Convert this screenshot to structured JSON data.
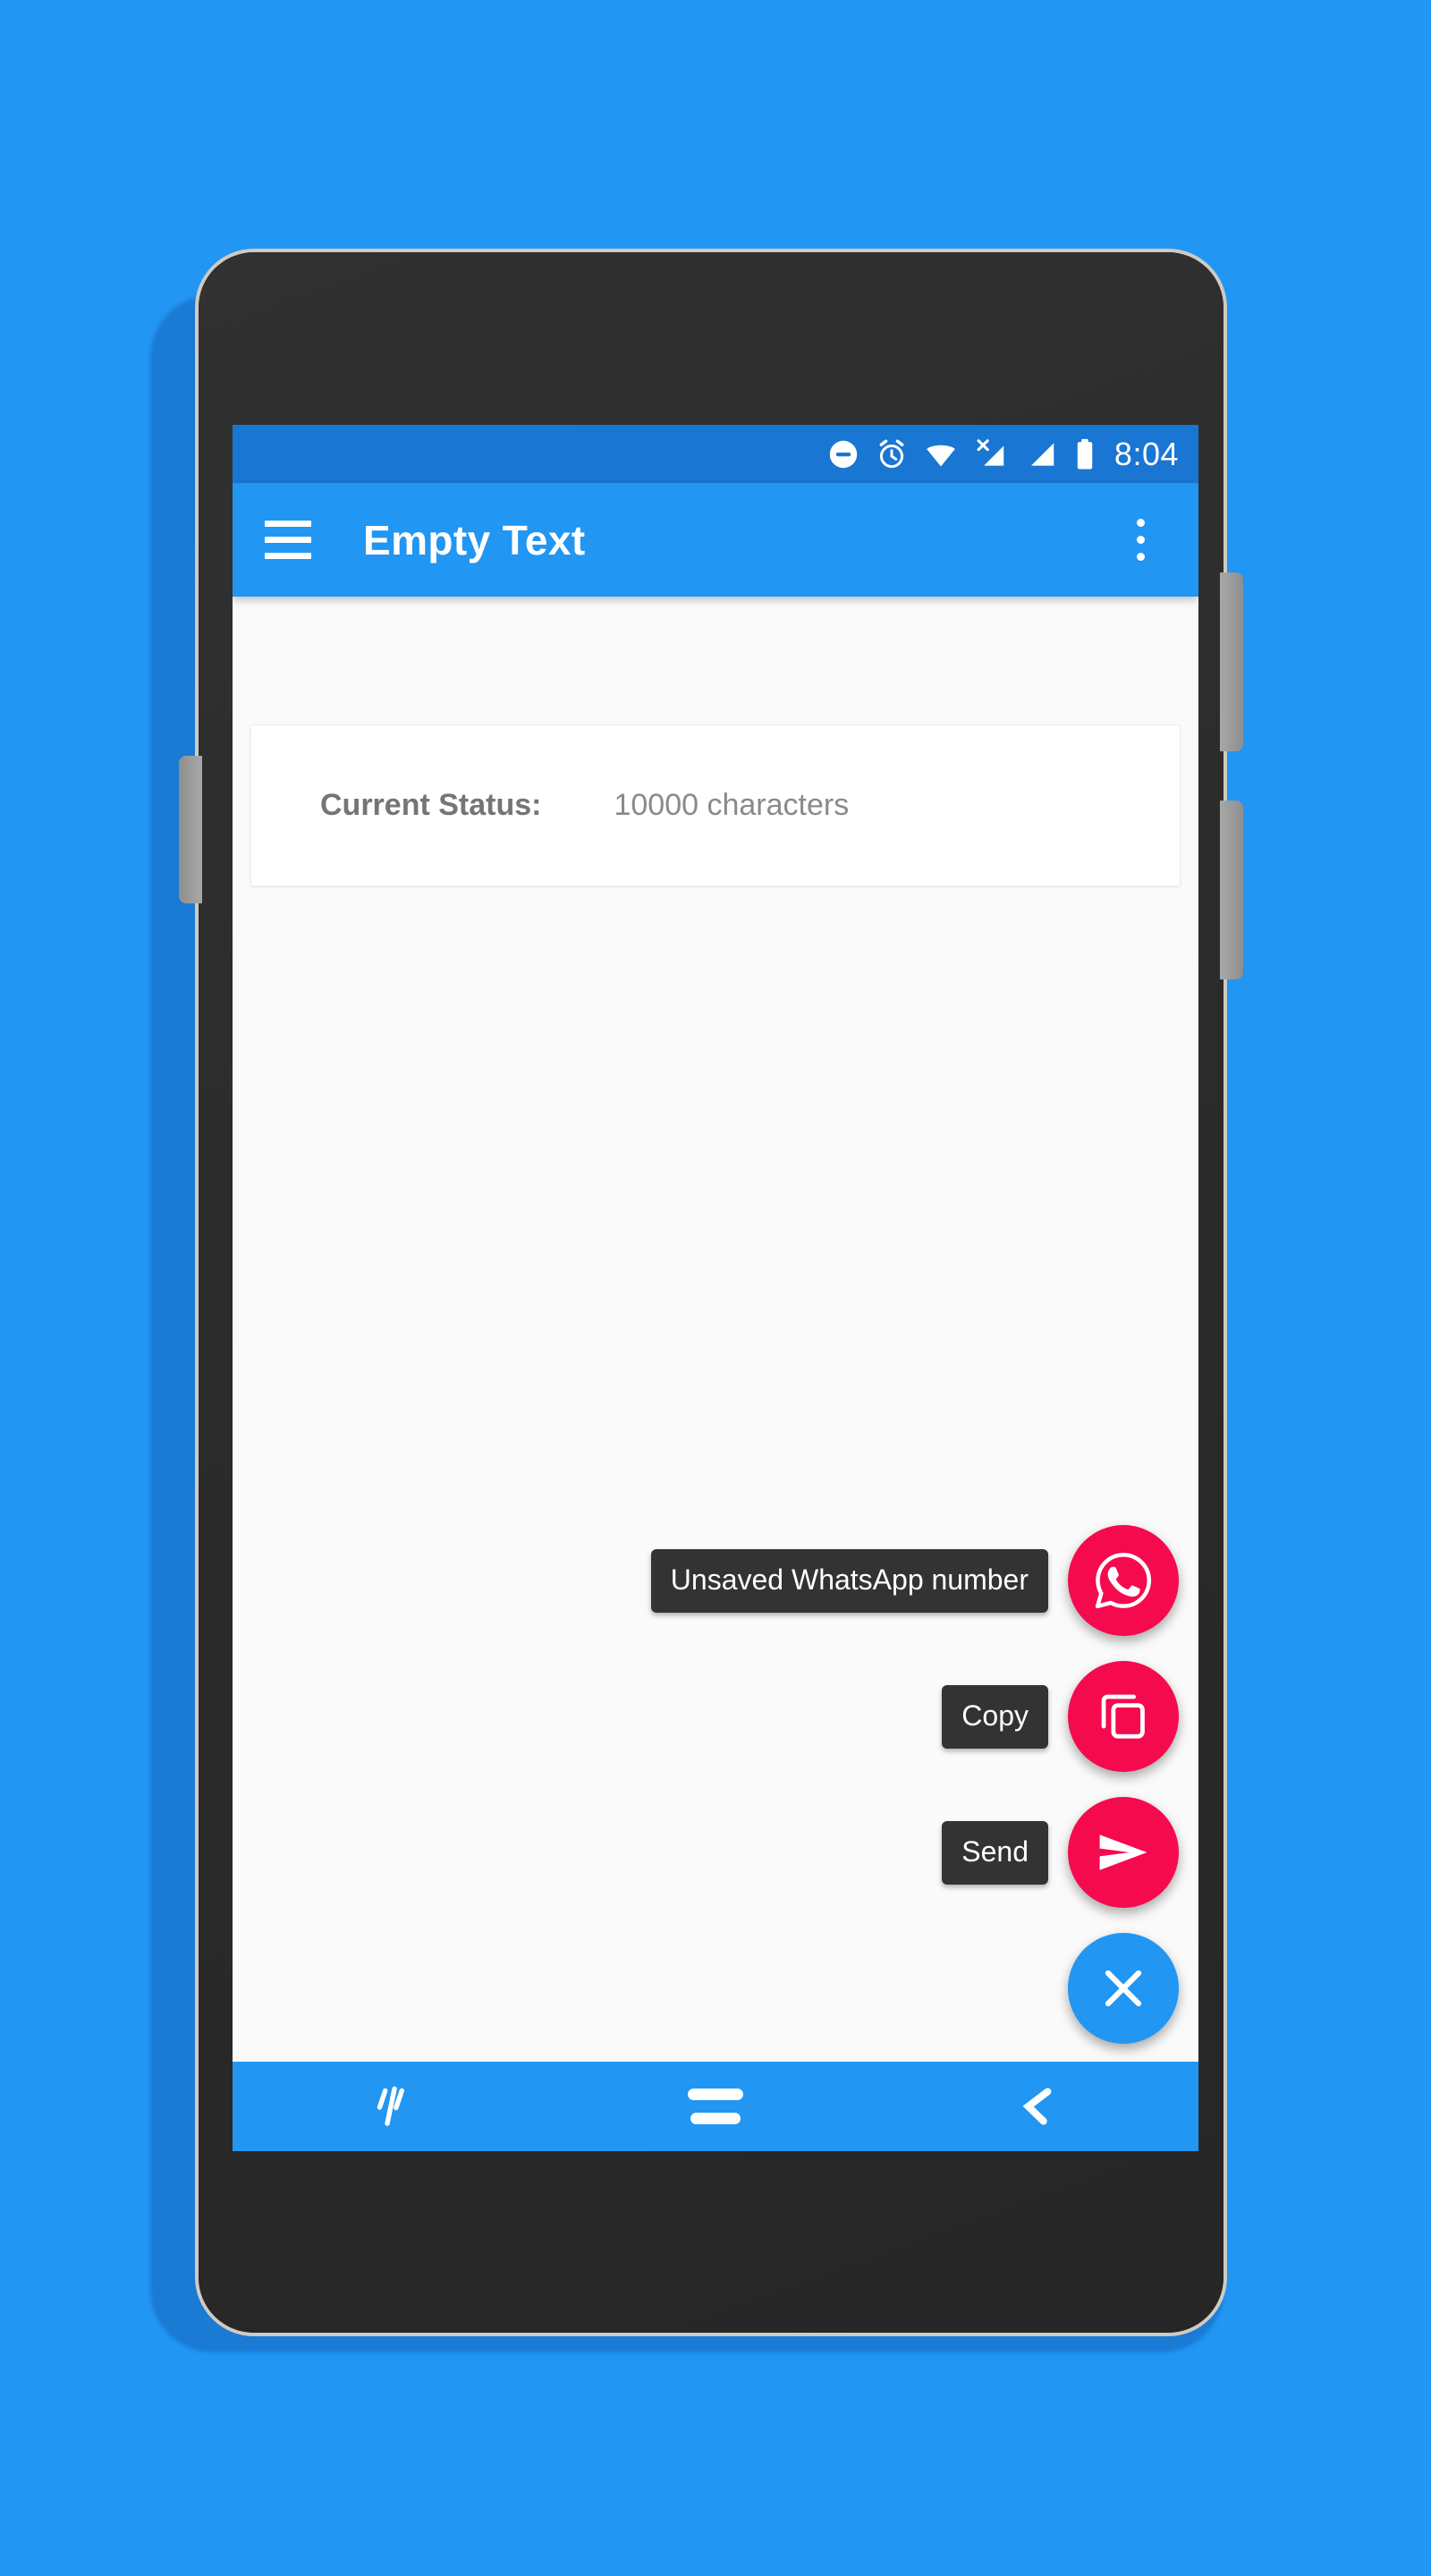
{
  "background": {
    "color": "#2196F3"
  },
  "device": {
    "body_color": "#2b2b2b",
    "bezel_color": "#cfcbc2",
    "shadow_color": "#1B7AD4",
    "parts": {
      "earpiece": "earpiece-speaker",
      "front_camera": "front-camera",
      "home_button": "home-button",
      "power_button": "power-button",
      "volume_up_button": "volume-up-button",
      "volume_down_button": "volume-down-button"
    }
  },
  "status_bar": {
    "background": "#1976D2",
    "time": "8:04",
    "icons": [
      {
        "name": "do-not-disturb-icon",
        "label": "Do not disturb"
      },
      {
        "name": "alarm-clock-icon",
        "label": "Alarm set"
      },
      {
        "name": "wifi-icon",
        "label": "Wi-Fi connected"
      },
      {
        "name": "signal-no-sim-icon",
        "label": "No SIM signal"
      },
      {
        "name": "signal-icon",
        "label": "Mobile signal"
      },
      {
        "name": "battery-icon",
        "label": "Battery full"
      }
    ]
  },
  "app_bar": {
    "background": "#2196F3",
    "title": "Empty Text",
    "navigation_icon": "hamburger-menu-icon",
    "overflow_icon": "overflow-menu-icon"
  },
  "content": {
    "background": "#FAFAFA",
    "status_card": {
      "label": "Current Status:",
      "value": "10000 characters"
    }
  },
  "fab_menu": {
    "expanded": true,
    "accent_color": "#F50A4E",
    "close_color": "#2196F3",
    "actions": [
      {
        "label": "Unsaved WhatsApp number",
        "icon": "whatsapp-icon",
        "color": "#F50A4E"
      },
      {
        "label": "Copy",
        "icon": "copy-icon",
        "color": "#F50A4E"
      },
      {
        "label": "Send",
        "icon": "send-icon",
        "color": "#F50A4E"
      }
    ],
    "close_button": {
      "label": "",
      "icon": "close-icon",
      "color": "#2196F3"
    }
  },
  "nav_bar": {
    "background": "#2196F3",
    "buttons": [
      {
        "name": "recents-button",
        "icon": "recents-slashes-icon"
      },
      {
        "name": "home-button",
        "icon": "home-bars-icon"
      },
      {
        "name": "back-button",
        "icon": "back-chevron-icon"
      }
    ]
  }
}
